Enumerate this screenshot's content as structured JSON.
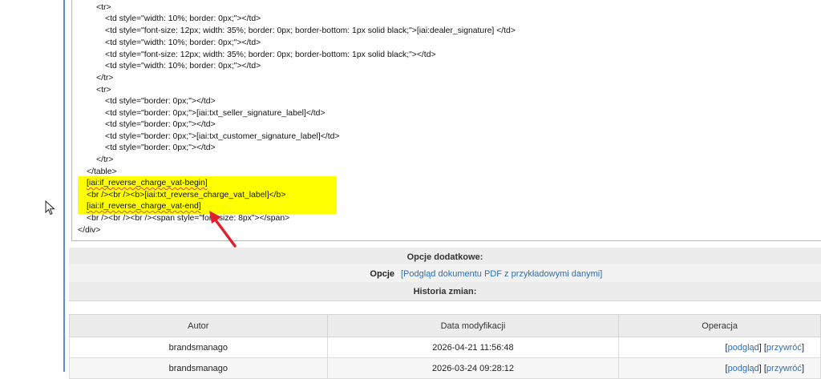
{
  "code_lines": [
    "<tr>",
    "<td style=\"width: 10%; border: 0px;\"></td>",
    "<td style=\"font-size: 12px; width: 35%; border: 0px; border-bottom: 1px solid black;\">[iai:dealer_signature] </td>",
    "<td style=\"width: 10%; border: 0px;\"></td>",
    "<td style=\"font-size: 12px; width: 35%; border: 0px; border-bottom: 1px solid black;\"></td>",
    "<td style=\"width: 10%; border: 0px;\"></td>",
    "</tr>",
    "<tr>",
    "<td style=\"border: 0px;\"></td>",
    "<td style=\"border: 0px;\">[iai:txt_seller_signature_label]</td>",
    "<td style=\"border: 0px;\"></td>",
    "<td style=\"border: 0px;\">[iai:txt_customer_signature_label]</td>",
    "<td style=\"border: 0px;\"></td>",
    "</tr>",
    "</table>",
    "[iai:if_reverse_charge_vat-begin]",
    "<br /><br /><b>[iai:txt_reverse_charge_vat_label]</b>",
    "[iai:if_reverse_charge_vat-end]",
    "<br /><br /><br /><span style=\"font-size: 8px\"></span>",
    "</div>"
  ],
  "options_panel": {
    "title": "Opcje dodatkowe:",
    "label": "Opcje",
    "value": "[Podgląd dokumentu PDF z przykładowymi danymi]"
  },
  "history_panel": {
    "title": "Historia zmian:"
  },
  "history_table": {
    "headers": [
      "Autor",
      "Data modyfikacji",
      "Operacja"
    ],
    "rows": [
      {
        "author": "brandsmanago",
        "date": "2026-04-21 11:56:48",
        "ops": [
          "[",
          "podgląd",
          "] [",
          "przywróć",
          "]"
        ]
      },
      {
        "author": "brandsmanago",
        "date": "2026-03-24 09:28:12",
        "ops": [
          "[",
          "podgląd",
          "] [",
          "przywróć",
          "]"
        ]
      }
    ]
  },
  "colors": {
    "highlight": "#ffff00",
    "link": "#2a6ebb",
    "arrow": "#e0202a"
  }
}
